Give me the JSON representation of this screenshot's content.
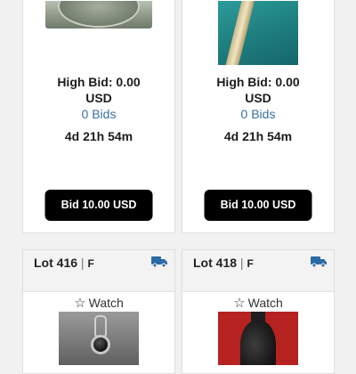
{
  "cards_top": [
    {
      "high_bid": "High Bid: 0.00 USD",
      "bids": "0 Bids",
      "time_left": "4d 21h 54m",
      "bid_button": "Bid 10.00 USD"
    },
    {
      "high_bid": "High Bid: 0.00 USD",
      "bids": "0 Bids",
      "time_left": "4d 21h 54m",
      "bid_button": "Bid 10.00 USD"
    }
  ],
  "cards_bottom": [
    {
      "lot_label": "Lot 416",
      "separator": "|",
      "category": "F",
      "watch_label": "Watch",
      "watch_icon": "star-outline-icon",
      "shipping_icon": "truck-icon"
    },
    {
      "lot_label": "Lot 418",
      "separator": "|",
      "category": "F",
      "watch_label": "Watch",
      "watch_icon": "star-outline-icon",
      "shipping_icon": "truck-icon"
    }
  ],
  "colors": {
    "accent_link": "#3a6fa0",
    "truck": "#2d6aa5",
    "button_bg": "#000000"
  }
}
